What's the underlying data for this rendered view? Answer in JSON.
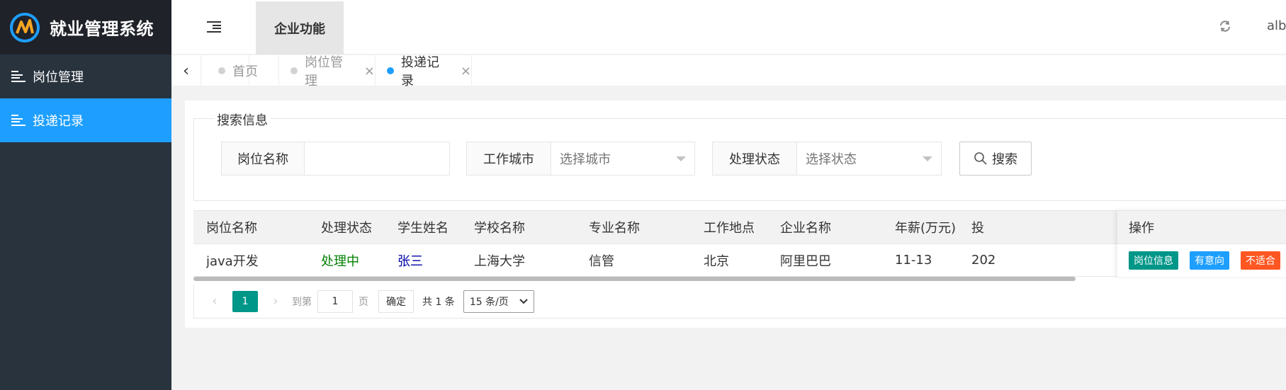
{
  "app": {
    "title": "就业管理系统"
  },
  "sidebar": {
    "items": [
      {
        "label": "岗位管理"
      },
      {
        "label": "投递记录"
      }
    ]
  },
  "header": {
    "tab_label": "企业功能",
    "user": "albb"
  },
  "tabs": [
    {
      "label": "首页"
    },
    {
      "label": "岗位管理"
    },
    {
      "label": "投递记录"
    }
  ],
  "search": {
    "legend": "搜索信息",
    "job_name_label": "岗位名称",
    "job_name_value": "",
    "city_label": "工作城市",
    "city_placeholder": "选择城市",
    "status_label": "处理状态",
    "status_placeholder": "选择状态",
    "button_label": "搜索"
  },
  "table": {
    "columns": [
      "岗位名称",
      "处理状态",
      "学生姓名",
      "学校名称",
      "专业名称",
      "工作地点",
      "企业名称",
      "年薪(万元)",
      "投"
    ],
    "rows": [
      {
        "job": "java开发",
        "status": "处理中",
        "student": "张三",
        "school": "上海大学",
        "major": "信管",
        "location": "北京",
        "company": "阿里巴巴",
        "salary": "11-13",
        "date": "202"
      }
    ],
    "action_header": "操作",
    "actions": [
      "岗位信息",
      "有意向",
      "不适合"
    ]
  },
  "pager": {
    "current": "1",
    "goto_label": "到第",
    "goto_value": "1",
    "page_label": "页",
    "confirm_label": "确定",
    "total_label": "共 1 条",
    "page_size": "15 条/页"
  },
  "colors": {
    "sidebar_bg": "#28333e",
    "logo_bg": "#20222a",
    "accent_blue": "#1e9fff",
    "teal": "#009688",
    "orange": "#ff5722",
    "status_green": "#008000",
    "student_blue": "#0000aa"
  }
}
